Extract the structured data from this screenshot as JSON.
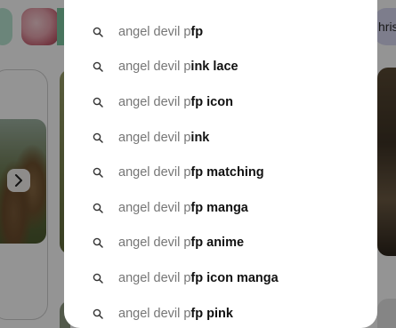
{
  "background": {
    "right_chip_label": "hris",
    "accent_colors": {
      "chip_mint": "#b9e6d3",
      "chip_green": "#7dc9a3",
      "chip_lavender": "#d7d7f2"
    },
    "carousel_arrow_icon": "chevron-right-icon"
  },
  "search": {
    "query": "angel devil p",
    "suggestions": [
      {
        "prefix": "angel devil p",
        "completion": "fp"
      },
      {
        "prefix": "angel devil p",
        "completion": "ink lace"
      },
      {
        "prefix": "angel devil p",
        "completion": "fp icon"
      },
      {
        "prefix": "angel devil p",
        "completion": "ink"
      },
      {
        "prefix": "angel devil p",
        "completion": "fp matching"
      },
      {
        "prefix": "angel devil p",
        "completion": "fp manga"
      },
      {
        "prefix": "angel devil p",
        "completion": "fp anime"
      },
      {
        "prefix": "angel devil p",
        "completion": "fp icon manga"
      },
      {
        "prefix": "angel devil p",
        "completion": "fp pink"
      }
    ],
    "suggestion_icon": "search-icon"
  }
}
